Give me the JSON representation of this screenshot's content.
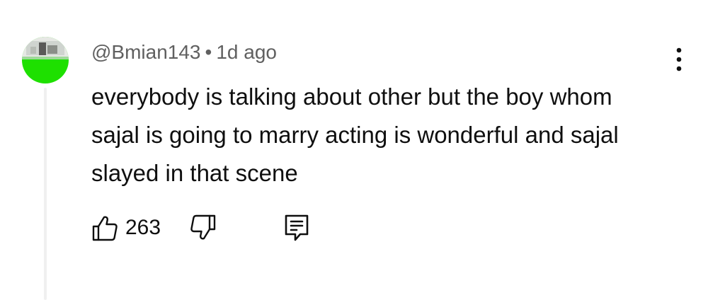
{
  "comment": {
    "author": "@Bmian143",
    "separator": "•",
    "time_ago": "1d ago",
    "text": "everybody is talking about other but the boy whom sajal is going to marry acting is wonderful and sajal slayed in that scene",
    "like_count": "263"
  },
  "icons": {
    "like": "thumbs-up-icon",
    "dislike": "thumbs-down-icon",
    "reply": "reply-comment-icon",
    "more": "more-vertical-icon"
  },
  "colors": {
    "text_primary": "#0f0f0f",
    "text_secondary": "#606060",
    "avatar_green": "#19e000"
  }
}
